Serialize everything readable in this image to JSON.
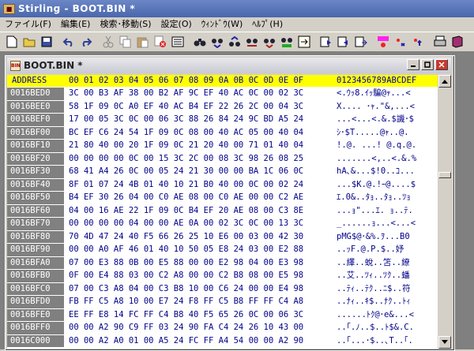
{
  "app": {
    "title": "Stirling - BOOT.BIN *"
  },
  "menu": [
    {
      "label": "ファイル(F)"
    },
    {
      "label": "編集(E)"
    },
    {
      "label": "検索･移動(S)"
    },
    {
      "label": "設定(O)"
    },
    {
      "label": "ｳｨﾝﾄﾞｳ(W)"
    },
    {
      "label": "ﾍﾙﾌﾟ(H)"
    }
  ],
  "toolbar_icons": [
    "new-file-icon",
    "open-folder-icon",
    "save-icon",
    "undo-icon",
    "redo-icon",
    "cut-icon",
    "copy-icon",
    "paste-icon",
    "delete-icon",
    "select-icon",
    "find-icon",
    "find-next-icon",
    "find-prev-icon",
    "find-hex-icon",
    "find-hex-next-icon",
    "replace-icon",
    "jump-icon",
    "insert-mode-icon",
    "overwrite-mode-icon",
    "move-icon",
    "macro-icon",
    "stop-macro-icon",
    "run-macro-icon",
    "print-icon",
    "settings-book-icon"
  ],
  "document": {
    "title": "BOOT.BIN *"
  },
  "hex_header": {
    "address_label": "ADDRESS",
    "columns": "00 01 02 03 04 05 06 07 08 09 0A 0B 0C 0D 0E 0F",
    "ascii_label": "0123456789ABCDEF"
  },
  "rows": [
    {
      "addr": "0016BED0",
      "hex": "3C 00 B3 AF 38 00 B2 AF 9C EF 40 AC 0C 00 02 3C",
      "ascii": "<.ｳｯ8.ｲｯ騙@ｬ...<"
    },
    {
      "addr": "0016BEE0",
      "hex": "58 1F 09 0C A0 EF 40 AC B4 EF 22 26 2C 00 04 3C",
      "ascii": "X.... ･ｬ.\"&,...<"
    },
    {
      "addr": "0016BEF0",
      "hex": "17 00 05 3C 0C 00 06 3C 88 26 84 24 9C BD A5 24",
      "ascii": "...<...<.&.$譏･$"
    },
    {
      "addr": "0016BF00",
      "hex": "BC EF C6 24 54 1F 09 0C 08 00 40 AC 05 00 40 04",
      "ascii": "ｼ･$T.....@ｬ..@."
    },
    {
      "addr": "0016BF10",
      "hex": "21 80 40 00 20 1F 09 0C 21 20 40 00 71 01 40 04",
      "ascii": "!.@. ...! @.q.@."
    },
    {
      "addr": "0016BF20",
      "hex": "00 00 00 00 0C 00 15 3C 2C 00 08 3C 98 26 08 25",
      "ascii": ".......<,..<.&.%"
    },
    {
      "addr": "0016BF30",
      "hex": "68 41 A4 26 0C 00 05 24 21 30 00 00 BA 1C 06 0C",
      "ascii": "hA､&...$!0..ｺ..."
    },
    {
      "addr": "0016BF40",
      "hex": "8F 01 07 24 4B 01 40 10 21 B0 40 00 0C 00 02 24",
      "ascii": "...$K.@.!ｰ@....$"
    },
    {
      "addr": "0016BF50",
      "hex": "B4 EF 30 26 04 00 C0 AE 08 00 C0 AE 00 00 C2 AE",
      "ascii": "ｴ.0&..ﾀｮ..ﾀｮ..ﾂｮ"
    },
    {
      "addr": "0016BF60",
      "hex": "04 00 16 AE 22 1F 09 0C B4 EF 20 AE 08 00 C3 8E",
      "ascii": "...ｮ\"...ｴ. ｮ..ﾃ."
    },
    {
      "addr": "0016BF70",
      "hex": "00 00 00 00 04 00 00 AE 0A 00 02 3C 0C 00 13 3C",
      "ascii": "_......ｮ...<...<"
    },
    {
      "addr": "0016BF80",
      "hex": "70 4D 47 24 40 F5 66 26 25 10 E6 00 03 00 42 30",
      "ascii": "pMG$@･&%.ｦ...B0"
    },
    {
      "addr": "0016BF90",
      "hex": "00 00 A0 AF 46 01 40 10 50 05 E8 24 03 00 E2 88",
      "ascii": "..ｯF.@.P.$..妤"
    },
    {
      "addr": "0016BFA0",
      "hex": "07 00 E3 88 0B 00 E5 88 00 00 E2 98 04 00 E3 98",
      "ascii": "..繹..蛻..笘..繚"
    },
    {
      "addr": "0016BFB0",
      "hex": "0F 00 E4 88 03 00 C2 A8 00 00 C2 B8 08 00 E5 98",
      "ascii": "..艾..ﾂｨ..ﾂｸ..蟠"
    },
    {
      "addr": "0016BFC0",
      "hex": "07 00 C3 A8 04 00 C3 B8 10 00 C6 24 00 00 E4 98",
      "ascii": "..ﾃｨ..ﾃｸ..ﾆ$..符"
    },
    {
      "addr": "0016BFD0",
      "hex": "FB FF C5 A8 10 00 E7 24 F8 FF C5 B8 FF FF C4 A8",
      "ascii": "..ﾅｨ..ｷ$..ﾅｸ..ﾄｨ"
    },
    {
      "addr": "0016BFE0",
      "hex": "EE FF E8 14 FC FF C4 B8 40 F5 65 26 0C 00 06 3C",
      "ascii": "......ﾄｸ@･e&...<"
    },
    {
      "addr": "0016BFF0",
      "hex": "00 00 A2 90 C9 FF 03 24 90 FA C4 24 26 10 43 00",
      "ascii": "..｢.ﾉ..$..ﾄ$&.C."
    },
    {
      "addr": "0016C000",
      "hex": "00 00 A2 A0 01 00 A5 24 FC FF A4 54 00 00 A2 90",
      "ascii": "..｢...･$..､T..｢."
    }
  ]
}
